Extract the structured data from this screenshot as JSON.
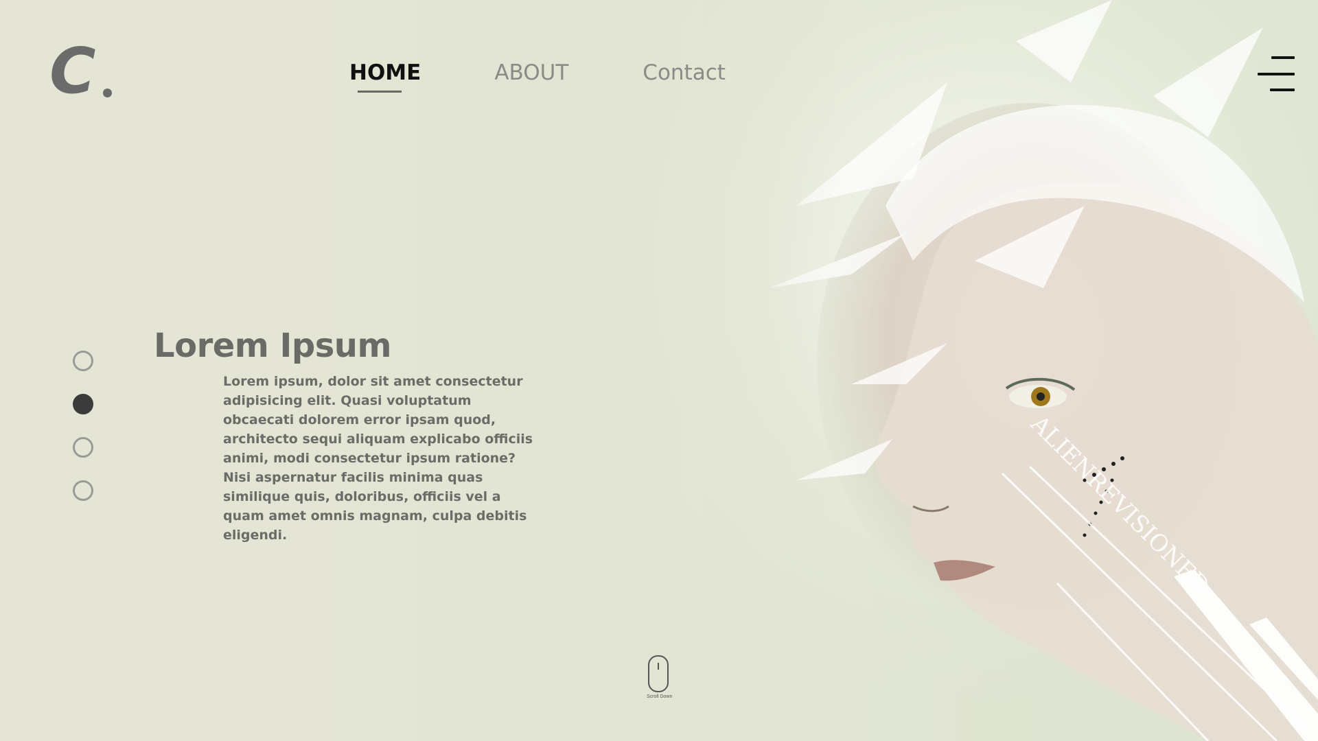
{
  "brand": {
    "logo_letter": "C"
  },
  "nav": {
    "items": [
      {
        "label": "HOME",
        "active": true
      },
      {
        "label": "ABOUT",
        "active": false
      },
      {
        "label": "Contact",
        "active": false
      }
    ]
  },
  "hero": {
    "title": "Lorem Ipsum",
    "body": "Lorem ipsum, dolor sit amet consectetur adipisicing elit. Quasi voluptatum obcaecati dolorem error ipsam quod, architecto sequi aliquam explicabo officiis animi, modi consectetur ipsum ratione? Nisi aspernatur facilis minima quas similique quis, doloribus, officiis vel a quam amet omnis magnam, culpa debitis eligendi.",
    "artwork_text": "ALIENREVISIONED",
    "slides": {
      "count": 4,
      "active_index": 1
    }
  },
  "scroll": {
    "label": "Scroll Down"
  },
  "icons": {
    "menu": "hamburger-menu-icon",
    "scroll": "mouse-scroll-icon"
  },
  "colors": {
    "background": "#e4e5d5",
    "text_muted": "#6b6b6b",
    "nav_active": "#111111",
    "nav_inactive": "#8a8a86",
    "dot_active": "#3b3b3b",
    "dot_inactive": "#9a9a96"
  }
}
